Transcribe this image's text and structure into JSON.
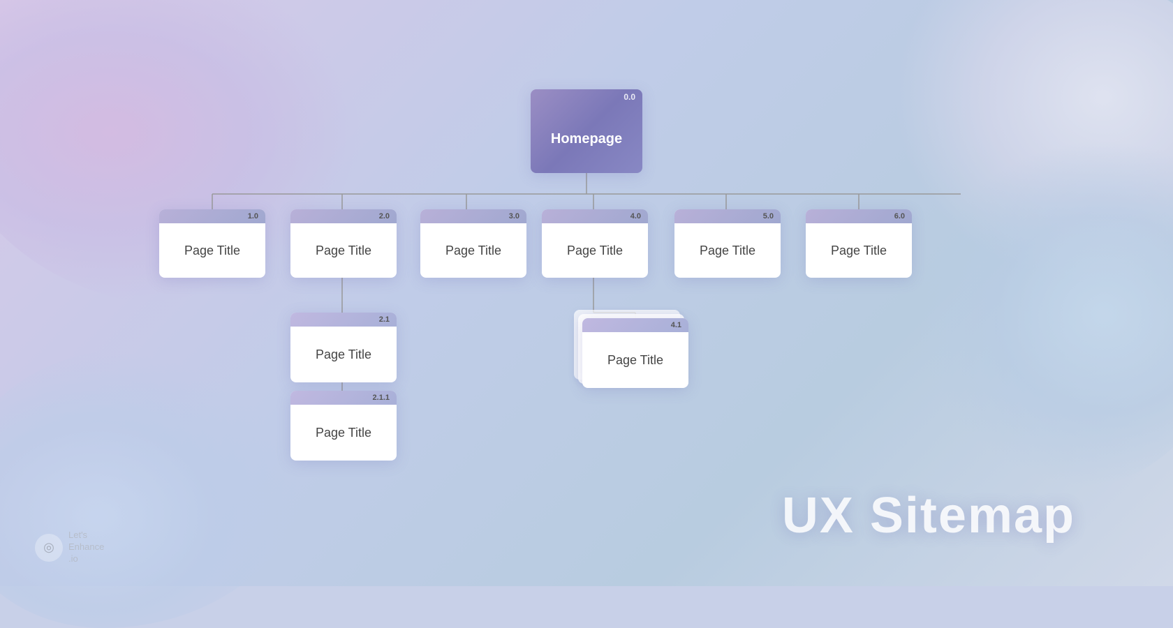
{
  "title": "UX Sitemap",
  "logo": {
    "text_line1": "Let's",
    "text_line2": "Enhance",
    "text_line3": ".io"
  },
  "nodes": {
    "homepage": {
      "id": "0.0",
      "label": "Homepage"
    },
    "level1": [
      {
        "id": "1.0",
        "label": "Page Title"
      },
      {
        "id": "2.0",
        "label": "Page Title"
      },
      {
        "id": "3.0",
        "label": "Page Title"
      },
      {
        "id": "4.0",
        "label": "Page Title"
      },
      {
        "id": "5.0",
        "label": "Page Title"
      },
      {
        "id": "6.0",
        "label": "Page Title"
      }
    ],
    "level2": [
      {
        "id": "2.1",
        "label": "Page Title",
        "parent": "2.0"
      },
      {
        "id": "4.1",
        "label": "Page Title",
        "parent": "4.0",
        "stacked": true
      }
    ],
    "level3": [
      {
        "id": "2.1.1",
        "label": "Page Title",
        "parent": "2.1"
      }
    ]
  }
}
